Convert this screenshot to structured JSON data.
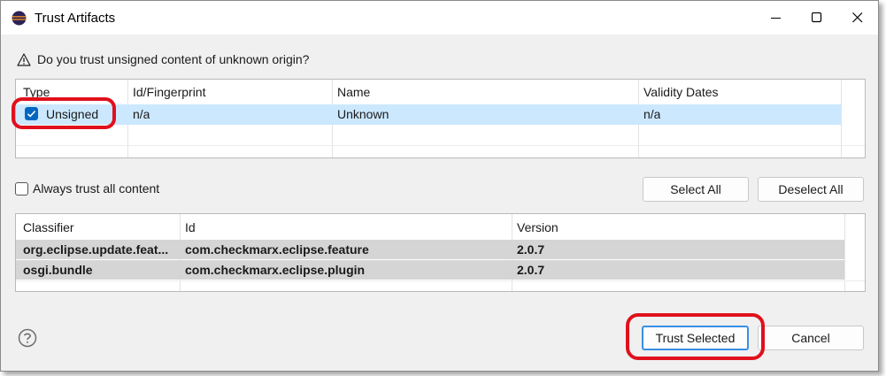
{
  "window": {
    "title": "Trust Artifacts",
    "icon": "eclipse-icon",
    "controls": [
      "minimize-icon",
      "maximize-icon",
      "close-icon"
    ]
  },
  "question": {
    "icon": "warning-icon",
    "text": "Do you trust unsigned content of unknown origin?"
  },
  "certs_table": {
    "headers": [
      "Type",
      "Id/Fingerprint",
      "Name",
      "Validity Dates"
    ],
    "rows": [
      {
        "type": "Unsigned",
        "checked": true,
        "id": "n/a",
        "name": "Unknown",
        "validity": "n/a"
      }
    ]
  },
  "always_trust": {
    "label": "Always trust all content",
    "checked": false
  },
  "select_all_label": "Select All",
  "deselect_all_label": "Deselect All",
  "artifacts_table": {
    "headers": [
      "Classifier",
      "Id",
      "Version"
    ],
    "rows": [
      {
        "classifier": "org.eclipse.update.feat...",
        "id": "com.checkmarx.eclipse.feature",
        "version": "2.0.7"
      },
      {
        "classifier": "osgi.bundle",
        "id": "com.checkmarx.eclipse.plugin",
        "version": "2.0.7"
      }
    ]
  },
  "footer": {
    "help_icon": "help-icon",
    "trust_selected_label": "Trust Selected",
    "cancel_label": "Cancel"
  },
  "colors": {
    "selection": "#cce8ff",
    "checkbox_blue": "#0067c0",
    "highlight_red": "#e0101c",
    "default_button_border": "#3a8ee6"
  }
}
